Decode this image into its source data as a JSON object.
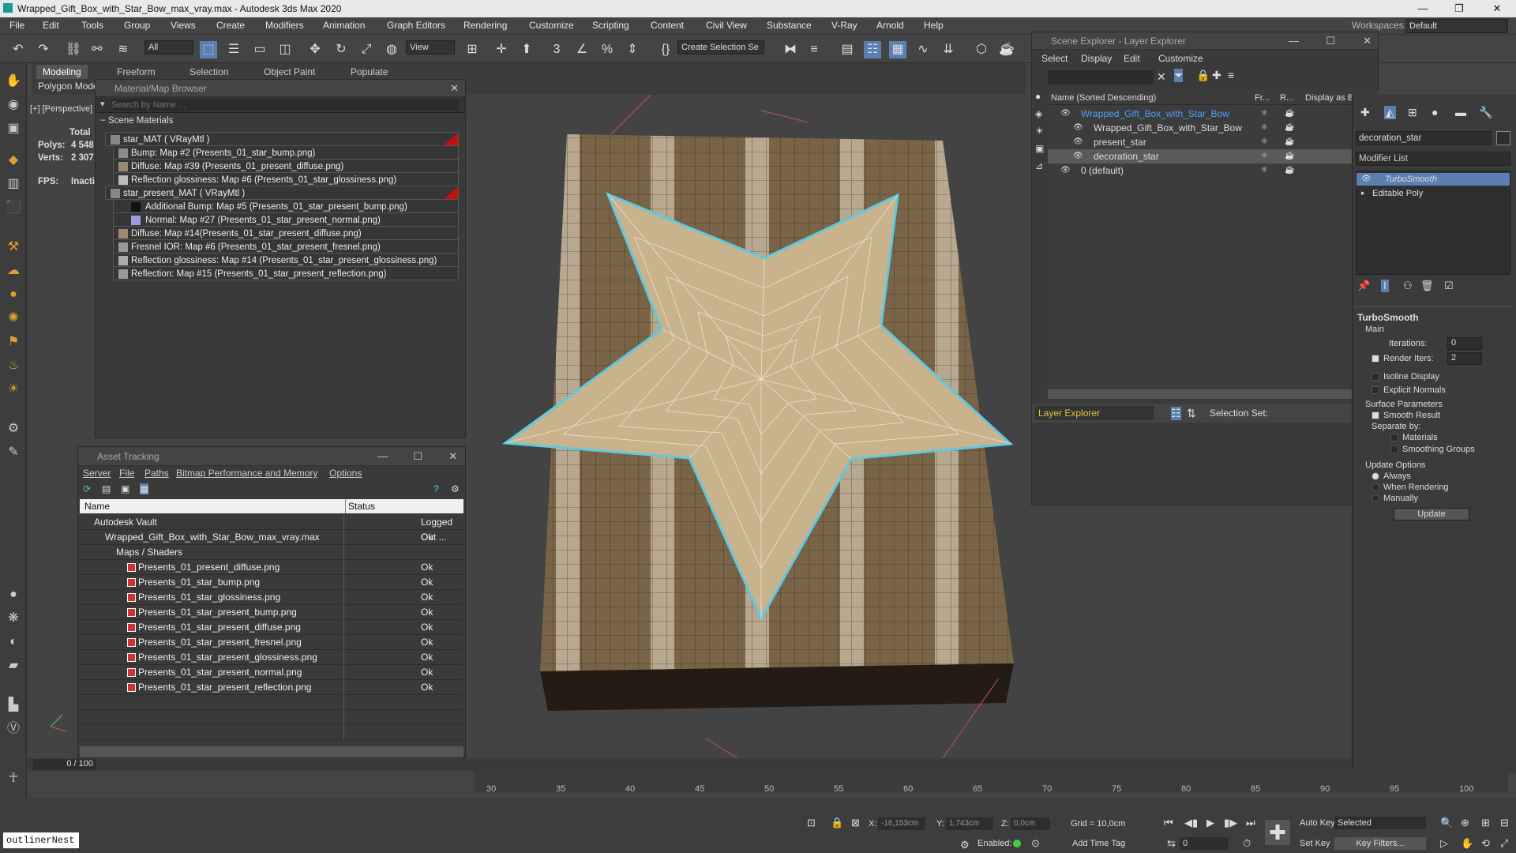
{
  "title_bar": {
    "title": "Wrapped_Gift_Box_with_Star_Bow_max_vray.max - Autodesk 3ds Max 2020",
    "minimize": "—",
    "maximize": "❐",
    "close": "✕"
  },
  "menu": [
    "File",
    "Edit",
    "Tools",
    "Group",
    "Views",
    "Create",
    "Modifiers",
    "Animation",
    "Graph Editors",
    "Rendering",
    "Customize",
    "Scripting",
    "Content",
    "Civil View",
    "Substance",
    "V-Ray",
    "Arnold",
    "Help"
  ],
  "workspaces": {
    "label": "Workspaces:",
    "value": "Default"
  },
  "toolbar": {
    "selection_filter": "All",
    "view_dropdown": "View",
    "create_selection_set": "Create Selection Se"
  },
  "ribbon": {
    "tabs": [
      "Modeling",
      "Freeform",
      "Selection",
      "Object Paint",
      "Populate"
    ],
    "subtab": "Polygon Modeling"
  },
  "viewport": {
    "label": "[+] [Perspective] [S",
    "stats_total": "Total",
    "polys_label": "Polys:",
    "polys_value": "4 548",
    "verts_label": "Verts:",
    "verts_value": "2 307",
    "fps_label": "FPS:",
    "fps_value": "Inactive"
  },
  "material_browser": {
    "title": "Material/Map Browser",
    "search_placeholder": "Search by Name ...",
    "section": "Scene Materials",
    "rows": [
      {
        "text": "star_MAT  ( VRayMtl )",
        "swatch": "#888888",
        "level": 0,
        "flag": true
      },
      {
        "text": "Bump: Map #2 (Presents_01_star_bump.png)",
        "swatch": "#8a8a8a",
        "level": 1
      },
      {
        "text": "Diffuse: Map #39 (Presents_01_present_diffuse.png)",
        "swatch": "#9b8a70",
        "level": 1
      },
      {
        "text": "Reflection glossiness: Map #6 (Presents_01_star_glossiness.png)",
        "swatch": "#bbbbbb",
        "level": 1
      },
      {
        "text": "star_present_MAT  ( VRayMtl )",
        "swatch": "#888888",
        "level": 0,
        "flag": true
      },
      {
        "text": "Additional Bump: Map #5 (Presents_01_star_present_bump.png)",
        "swatch": "#111111",
        "level": 2
      },
      {
        "text": "Normal: Map #27 (Presents_01_star_present_normal.png)",
        "swatch": "#9b9bdd",
        "level": 2
      },
      {
        "text": "Diffuse: Map #14(Presents_01_star_present_diffuse.png)",
        "swatch": "#9b8a70",
        "level": 1
      },
      {
        "text": "Fresnel IOR: Map #6 (Presents_01_star_present_fresnel.png)",
        "swatch": "#999999",
        "level": 1
      },
      {
        "text": "Reflection glossiness: Map #14 (Presents_01_star_present_glossiness.png)",
        "swatch": "#aaaaaa",
        "level": 1
      },
      {
        "text": "Reflection: Map #15 (Presents_01_star_present_reflection.png)",
        "swatch": "#999999",
        "level": 1
      }
    ]
  },
  "asset_tracking": {
    "title": "Asset Tracking",
    "menu": [
      "Server",
      "File",
      "Paths",
      "Bitmap Performance and Memory",
      "Options"
    ],
    "col_name": "Name",
    "col_status": "Status",
    "rows": [
      {
        "name": "Autodesk Vault",
        "status": "Logged Out ...",
        "indent": 1
      },
      {
        "name": "Wrapped_Gift_Box_with_Star_Bow_max_vray.max",
        "status": "Ok",
        "indent": 2
      },
      {
        "name": "Maps / Shaders",
        "status": "",
        "indent": 3
      },
      {
        "name": "Presents_01_present_diffuse.png",
        "status": "Ok",
        "indent": 4,
        "png": true
      },
      {
        "name": "Presents_01_star_bump.png",
        "status": "Ok",
        "indent": 4,
        "png": true
      },
      {
        "name": "Presents_01_star_glossiness.png",
        "status": "Ok",
        "indent": 4,
        "png": true
      },
      {
        "name": "Presents_01_star_present_bump.png",
        "status": "Ok",
        "indent": 4,
        "png": true
      },
      {
        "name": "Presents_01_star_present_diffuse.png",
        "status": "Ok",
        "indent": 4,
        "png": true
      },
      {
        "name": "Presents_01_star_present_fresnel.png",
        "status": "Ok",
        "indent": 4,
        "png": true
      },
      {
        "name": "Presents_01_star_present_glossiness.png",
        "status": "Ok",
        "indent": 4,
        "png": true
      },
      {
        "name": "Presents_01_star_present_normal.png",
        "status": "Ok",
        "indent": 4,
        "png": true
      },
      {
        "name": "Presents_01_star_present_reflection.png",
        "status": "Ok",
        "indent": 4,
        "png": true
      }
    ]
  },
  "scene_explorer": {
    "title": "Scene Explorer - Layer Explorer",
    "menu": [
      "Select",
      "Display",
      "Edit",
      "Customize"
    ],
    "col_name": "Name (Sorted Descending)",
    "col_fr": "Fr...",
    "col_r": "R...",
    "col_display": "Display as Bo",
    "rows": [
      {
        "name": "Wrapped_Gift_Box_with_Star_Bow",
        "indent": 0,
        "color": "#4d9fff"
      },
      {
        "name": "Wrapped_Gift_Box_with_Star_Bow",
        "indent": 1,
        "color": "#dddddd"
      },
      {
        "name": "present_star",
        "indent": 1,
        "color": "#dddddd"
      },
      {
        "name": "decoration_star",
        "indent": 1,
        "color": "#dddddd",
        "selected": true
      },
      {
        "name": "0 (default)",
        "indent": 0,
        "color": "#dddddd"
      }
    ],
    "footer_layer": "Layer Explorer",
    "footer_selset": "Selection Set:"
  },
  "command_panel": {
    "object_name": "decoration_star",
    "modifier_list": "Modifier List",
    "stack": [
      "TurboSmooth",
      "Editable Poly"
    ],
    "rollout_title": "TurboSmooth",
    "main_label": "Main",
    "iterations_label": "Iterations:",
    "iterations_value": "0",
    "render_iters_label": "Render Iters:",
    "render_iters_value": "2",
    "isoline": "Isoline Display",
    "explicit": "Explicit Normals",
    "surface_params": "Surface Parameters",
    "smooth_result": "Smooth Result",
    "separate_by": "Separate by:",
    "materials": "Materials",
    "smoothing_groups": "Smoothing Groups",
    "update_options": "Update Options",
    "always": "Always",
    "when_rendering": "When Rendering",
    "manually": "Manually",
    "update_button": "Update"
  },
  "timeline": {
    "frame": "0 / 100",
    "ticks": [
      "30",
      "35",
      "40",
      "45",
      "50",
      "55",
      "60",
      "65",
      "70",
      "75",
      "80",
      "85",
      "90",
      "95",
      "100"
    ]
  },
  "status": {
    "x_label": "X:",
    "x_value": "-16,153cm",
    "y_label": "Y:",
    "y_value": "1,743cm",
    "z_label": "Z:",
    "z_value": "0,0cm",
    "grid": "Grid = 10,0cm",
    "enabled": "Enabled:",
    "add_time_tag": "Add Time Tag",
    "auto_key": "Auto Key",
    "selected": "Selected",
    "set_key": "Set Key",
    "key_filters": "Key Filters...",
    "frame_value": "0",
    "script_listener": "outlinerNest"
  },
  "colors": {
    "accent": "#4d9fff",
    "selection": "#5ec9e0",
    "toolbar_bg": "#444444",
    "panel_bg": "#3a3a3a"
  }
}
